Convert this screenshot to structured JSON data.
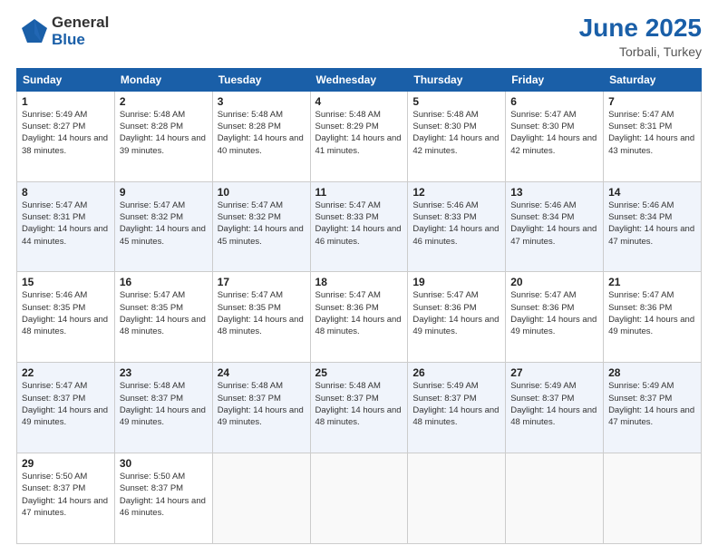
{
  "logo": {
    "general": "General",
    "blue": "Blue"
  },
  "title": {
    "month": "June 2025",
    "location": "Torbali, Turkey"
  },
  "headers": [
    "Sunday",
    "Monday",
    "Tuesday",
    "Wednesday",
    "Thursday",
    "Friday",
    "Saturday"
  ],
  "weeks": [
    [
      {
        "day": "1",
        "sunrise": "Sunrise: 5:49 AM",
        "sunset": "Sunset: 8:27 PM",
        "daylight": "Daylight: 14 hours and 38 minutes."
      },
      {
        "day": "2",
        "sunrise": "Sunrise: 5:48 AM",
        "sunset": "Sunset: 8:28 PM",
        "daylight": "Daylight: 14 hours and 39 minutes."
      },
      {
        "day": "3",
        "sunrise": "Sunrise: 5:48 AM",
        "sunset": "Sunset: 8:28 PM",
        "daylight": "Daylight: 14 hours and 40 minutes."
      },
      {
        "day": "4",
        "sunrise": "Sunrise: 5:48 AM",
        "sunset": "Sunset: 8:29 PM",
        "daylight": "Daylight: 14 hours and 41 minutes."
      },
      {
        "day": "5",
        "sunrise": "Sunrise: 5:48 AM",
        "sunset": "Sunset: 8:30 PM",
        "daylight": "Daylight: 14 hours and 42 minutes."
      },
      {
        "day": "6",
        "sunrise": "Sunrise: 5:47 AM",
        "sunset": "Sunset: 8:30 PM",
        "daylight": "Daylight: 14 hours and 42 minutes."
      },
      {
        "day": "7",
        "sunrise": "Sunrise: 5:47 AM",
        "sunset": "Sunset: 8:31 PM",
        "daylight": "Daylight: 14 hours and 43 minutes."
      }
    ],
    [
      {
        "day": "8",
        "sunrise": "Sunrise: 5:47 AM",
        "sunset": "Sunset: 8:31 PM",
        "daylight": "Daylight: 14 hours and 44 minutes."
      },
      {
        "day": "9",
        "sunrise": "Sunrise: 5:47 AM",
        "sunset": "Sunset: 8:32 PM",
        "daylight": "Daylight: 14 hours and 45 minutes."
      },
      {
        "day": "10",
        "sunrise": "Sunrise: 5:47 AM",
        "sunset": "Sunset: 8:32 PM",
        "daylight": "Daylight: 14 hours and 45 minutes."
      },
      {
        "day": "11",
        "sunrise": "Sunrise: 5:47 AM",
        "sunset": "Sunset: 8:33 PM",
        "daylight": "Daylight: 14 hours and 46 minutes."
      },
      {
        "day": "12",
        "sunrise": "Sunrise: 5:46 AM",
        "sunset": "Sunset: 8:33 PM",
        "daylight": "Daylight: 14 hours and 46 minutes."
      },
      {
        "day": "13",
        "sunrise": "Sunrise: 5:46 AM",
        "sunset": "Sunset: 8:34 PM",
        "daylight": "Daylight: 14 hours and 47 minutes."
      },
      {
        "day": "14",
        "sunrise": "Sunrise: 5:46 AM",
        "sunset": "Sunset: 8:34 PM",
        "daylight": "Daylight: 14 hours and 47 minutes."
      }
    ],
    [
      {
        "day": "15",
        "sunrise": "Sunrise: 5:46 AM",
        "sunset": "Sunset: 8:35 PM",
        "daylight": "Daylight: 14 hours and 48 minutes."
      },
      {
        "day": "16",
        "sunrise": "Sunrise: 5:47 AM",
        "sunset": "Sunset: 8:35 PM",
        "daylight": "Daylight: 14 hours and 48 minutes."
      },
      {
        "day": "17",
        "sunrise": "Sunrise: 5:47 AM",
        "sunset": "Sunset: 8:35 PM",
        "daylight": "Daylight: 14 hours and 48 minutes."
      },
      {
        "day": "18",
        "sunrise": "Sunrise: 5:47 AM",
        "sunset": "Sunset: 8:36 PM",
        "daylight": "Daylight: 14 hours and 48 minutes."
      },
      {
        "day": "19",
        "sunrise": "Sunrise: 5:47 AM",
        "sunset": "Sunset: 8:36 PM",
        "daylight": "Daylight: 14 hours and 49 minutes."
      },
      {
        "day": "20",
        "sunrise": "Sunrise: 5:47 AM",
        "sunset": "Sunset: 8:36 PM",
        "daylight": "Daylight: 14 hours and 49 minutes."
      },
      {
        "day": "21",
        "sunrise": "Sunrise: 5:47 AM",
        "sunset": "Sunset: 8:36 PM",
        "daylight": "Daylight: 14 hours and 49 minutes."
      }
    ],
    [
      {
        "day": "22",
        "sunrise": "Sunrise: 5:47 AM",
        "sunset": "Sunset: 8:37 PM",
        "daylight": "Daylight: 14 hours and 49 minutes."
      },
      {
        "day": "23",
        "sunrise": "Sunrise: 5:48 AM",
        "sunset": "Sunset: 8:37 PM",
        "daylight": "Daylight: 14 hours and 49 minutes."
      },
      {
        "day": "24",
        "sunrise": "Sunrise: 5:48 AM",
        "sunset": "Sunset: 8:37 PM",
        "daylight": "Daylight: 14 hours and 49 minutes."
      },
      {
        "day": "25",
        "sunrise": "Sunrise: 5:48 AM",
        "sunset": "Sunset: 8:37 PM",
        "daylight": "Daylight: 14 hours and 48 minutes."
      },
      {
        "day": "26",
        "sunrise": "Sunrise: 5:49 AM",
        "sunset": "Sunset: 8:37 PM",
        "daylight": "Daylight: 14 hours and 48 minutes."
      },
      {
        "day": "27",
        "sunrise": "Sunrise: 5:49 AM",
        "sunset": "Sunset: 8:37 PM",
        "daylight": "Daylight: 14 hours and 48 minutes."
      },
      {
        "day": "28",
        "sunrise": "Sunrise: 5:49 AM",
        "sunset": "Sunset: 8:37 PM",
        "daylight": "Daylight: 14 hours and 47 minutes."
      }
    ],
    [
      {
        "day": "29",
        "sunrise": "Sunrise: 5:50 AM",
        "sunset": "Sunset: 8:37 PM",
        "daylight": "Daylight: 14 hours and 47 minutes."
      },
      {
        "day": "30",
        "sunrise": "Sunrise: 5:50 AM",
        "sunset": "Sunset: 8:37 PM",
        "daylight": "Daylight: 14 hours and 46 minutes."
      },
      null,
      null,
      null,
      null,
      null
    ]
  ]
}
